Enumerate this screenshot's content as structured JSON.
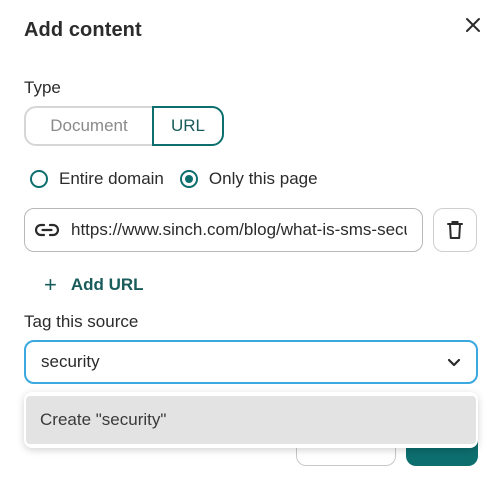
{
  "dialog": {
    "title": "Add content",
    "close_icon": "close-icon"
  },
  "type_section": {
    "label": "Type",
    "options": [
      {
        "label": "Document",
        "selected": false
      },
      {
        "label": "URL",
        "selected": true
      }
    ]
  },
  "scope": {
    "options": [
      {
        "label": "Entire domain",
        "checked": false
      },
      {
        "label": "Only this page",
        "checked": true
      }
    ]
  },
  "url_entry": {
    "icon": "link-icon",
    "value": "https://www.sinch.com/blog/what-is-sms-security/",
    "delete_icon": "trash-icon"
  },
  "add_url": {
    "label": "Add URL",
    "icon": "plus-icon"
  },
  "tag_section": {
    "label": "Tag this source",
    "input_value": "security",
    "chevron_icon": "chevron-down-icon",
    "dropdown_option": "Create \"security\""
  },
  "colors": {
    "accent": "#0d6e6e",
    "focus_border": "#3ba8e0",
    "option_highlight": "#e3e3e3"
  }
}
